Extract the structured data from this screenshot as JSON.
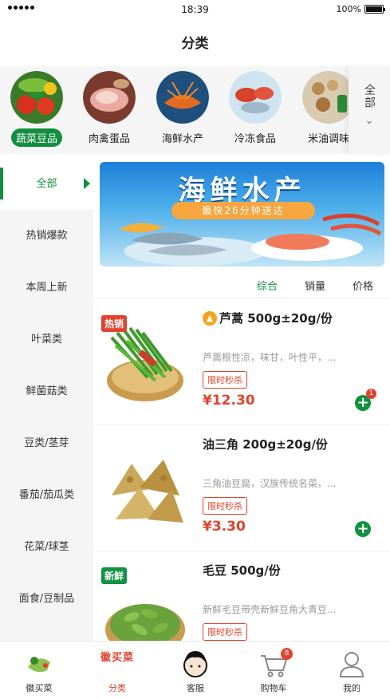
{
  "status_bar": {
    "time": "18:39",
    "battery": "100%"
  },
  "header": {
    "title": "分类"
  },
  "categories": [
    {
      "label": "蔬菜豆品",
      "active": true
    },
    {
      "label": "肉禽蛋品",
      "active": false
    },
    {
      "label": "海鲜水产",
      "active": false
    },
    {
      "label": "冷冻食品",
      "active": false
    },
    {
      "label": "米油调味",
      "active": false
    }
  ],
  "category_all": {
    "label": "全部"
  },
  "sidebar": {
    "items": [
      {
        "label": "全部",
        "active": true
      },
      {
        "label": "热销爆款"
      },
      {
        "label": "本周上新"
      },
      {
        "label": "叶菜类"
      },
      {
        "label": "鲜菌菇类"
      },
      {
        "label": "豆类/茎芽"
      },
      {
        "label": "番茄/茄瓜类"
      },
      {
        "label": "花菜/球茎"
      },
      {
        "label": "面食/豆制品"
      }
    ]
  },
  "banner": {
    "title": "海鲜水产",
    "subtitle": "最快26分钟送达"
  },
  "sort": {
    "items": [
      {
        "label": "综合",
        "active": true
      },
      {
        "label": "销量"
      },
      {
        "label": "价格"
      }
    ]
  },
  "products": [
    {
      "tag": "热销",
      "tag_color": "#e2422d",
      "name": "芦蒿 500g±20g/份",
      "hot_icon": true,
      "desc": "芦蒿根性凉，味甘，叶性平，...",
      "badge": "限时秒杀",
      "price": "¥12.30",
      "cart_count": "1"
    },
    {
      "tag": "",
      "tag_color": "",
      "name": "油三角 200g±20g/份",
      "hot_icon": false,
      "desc": "三角油豆腐，汉族传统名菜，...",
      "badge": "限时秒杀",
      "price": "¥3.30",
      "cart_count": ""
    },
    {
      "tag": "新鲜",
      "tag_color": "#12913f",
      "name": "毛豆 500g/份",
      "hot_icon": false,
      "desc": "新鲜毛豆带壳新鲜豆角大青豆...",
      "badge": "限时秒杀",
      "price": "",
      "cart_count": ""
    }
  ],
  "tab_bar": {
    "items": [
      {
        "label": "徽买菜",
        "icon": "logo-icon"
      },
      {
        "label": "分类",
        "icon": "category-icon",
        "active": true,
        "icon_text": "徽买菜"
      },
      {
        "label": "客服",
        "icon": "service-icon"
      },
      {
        "label": "购物车",
        "icon": "cart-icon",
        "badge": "8"
      },
      {
        "label": "我的",
        "icon": "profile-icon"
      }
    ]
  },
  "colors": {
    "brand_green": "#128e3f",
    "price_red": "#e2422d"
  }
}
